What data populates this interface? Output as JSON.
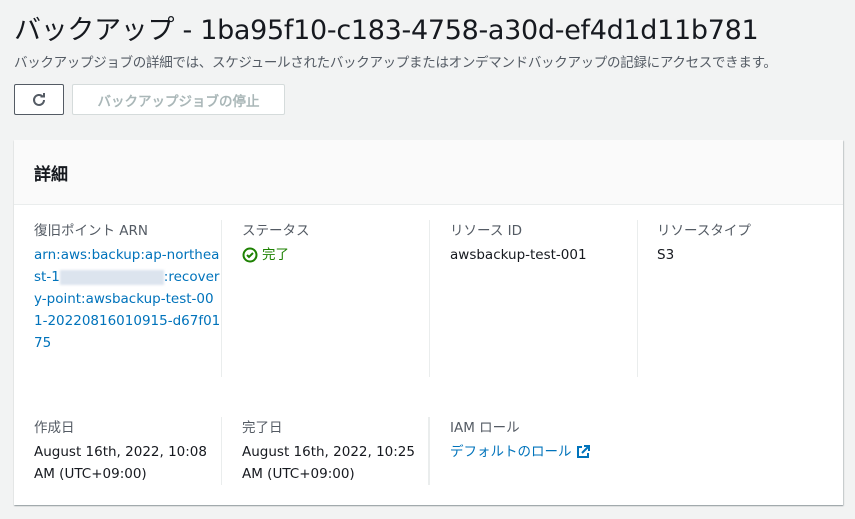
{
  "header": {
    "title": "バックアップ - 1ba95f10-c183-4758-a30d-ef4d1d11b781",
    "description": "バックアップジョブの詳細では、スケジュールされたバックアップまたはオンデマンドバックアップの記録にアクセスできます。"
  },
  "toolbar": {
    "refresh_icon": "refresh-icon",
    "stop_label": "バックアップジョブの停止"
  },
  "details": {
    "title": "詳細",
    "recovery_point": {
      "label": "復旧ポイント ARN",
      "value_prefix": "arn:aws:backup:ap-northeast-1",
      "value_suffix": ":recovery-point:awsbackup-test-001-20220816010915-d67f0175"
    },
    "status": {
      "label": "ステータス",
      "value": "完了",
      "color": "#1d8102"
    },
    "resource_id": {
      "label": "リソース ID",
      "value": "awsbackup-test-001"
    },
    "resource_type": {
      "label": "リソースタイプ",
      "value": "S3"
    },
    "created": {
      "label": "作成日",
      "value": "August 16th, 2022, 10:08 AM (UTC+09:00)"
    },
    "completed": {
      "label": "完了日",
      "value": "August 16th, 2022, 10:25 AM (UTC+09:00)"
    },
    "iam_role": {
      "label": "IAM ロール",
      "value": "デフォルトのロール"
    }
  }
}
